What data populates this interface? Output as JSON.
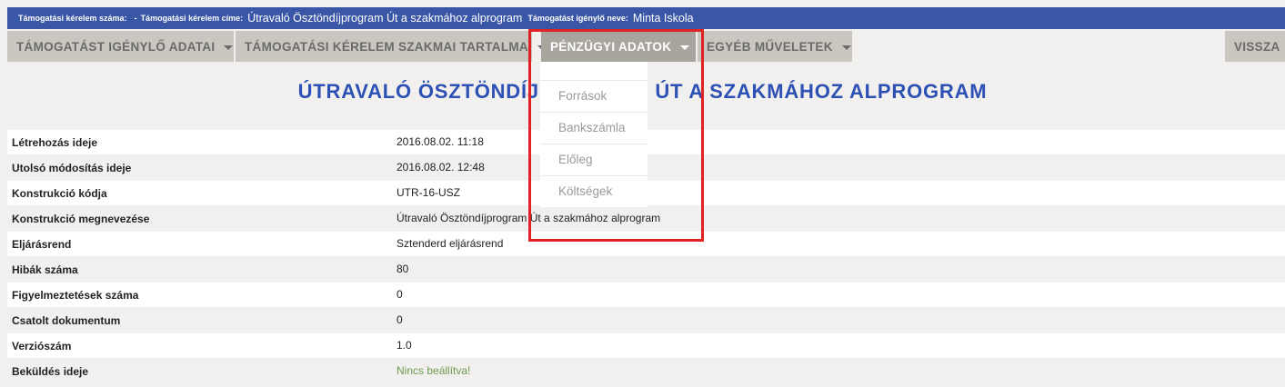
{
  "header": {
    "app_number_label": "Támogatási kérelem száma:",
    "app_number_value": "-",
    "app_title_label": "Támogatási kérelem címe:",
    "app_title_value": "Útravaló Ösztöndíjprogram Út a szakmához alprogram",
    "applicant_label": "Támogatást igénylő neve:",
    "applicant_value": "Minta Iskola"
  },
  "menu": {
    "items": [
      {
        "label": "TÁMOGATÁST IGÉNYLŐ ADATAI"
      },
      {
        "label": "TÁMOGATÁSI KÉRELEM SZAKMAI TARTALMA"
      },
      {
        "label": "PÉNZÜGYI ADATOK"
      },
      {
        "label": "EGYÉB MŰVELETEK"
      }
    ],
    "back_label": "VISSZA",
    "dropdown": [
      {
        "label": "Források"
      },
      {
        "label": "Bankszámla"
      },
      {
        "label": "Előleg"
      },
      {
        "label": "Költségek"
      }
    ]
  },
  "page_title": "ÚTRAVALÓ ÖSZTÖNDÍJPROGRAM ÚT A SZAKMÁHOZ ALPROGRAM",
  "details": [
    {
      "key": "Létrehozás ideje",
      "value": "2016.08.02. 11:18"
    },
    {
      "key": "Utolsó módosítás ideje",
      "value": "2016.08.02. 12:48"
    },
    {
      "key": "Konstrukció kódja",
      "value": "UTR-16-USZ"
    },
    {
      "key": "Konstrukció megnevezése",
      "value": "Útravaló Ösztöndíjprogram Út a szakmához alprogram"
    },
    {
      "key": "Eljárásrend",
      "value": "Sztenderd eljárásrend"
    },
    {
      "key": "Hibák száma",
      "value": "80"
    },
    {
      "key": "Figyelmeztetések száma",
      "value": "0"
    },
    {
      "key": "Csatolt dokumentum",
      "value": "0"
    },
    {
      "key": "Verziószám",
      "value": "1.0"
    },
    {
      "key": "Beküldés ideje",
      "value": "Nincs beállítva!"
    }
  ],
  "colors": {
    "header_bg": "#3a57a7",
    "title": "#2c50b3",
    "highlight": "#e02225",
    "not_set": "#6f9b4d"
  }
}
